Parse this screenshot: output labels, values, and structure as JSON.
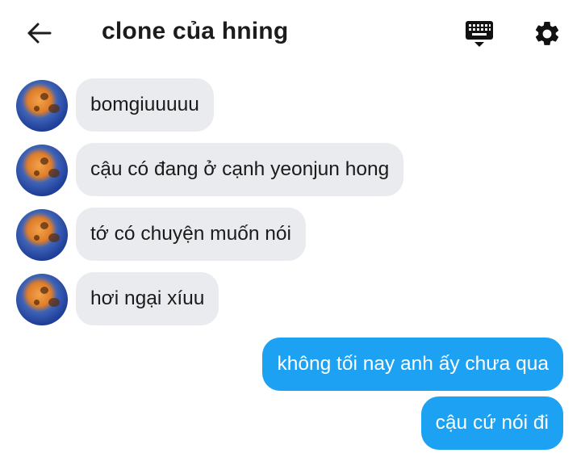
{
  "header": {
    "title": "clone của hning",
    "back_icon": "arrow-left-icon",
    "keyboard_icon": "keyboard-icon",
    "settings_icon": "gear-icon"
  },
  "messages": [
    {
      "side": "incoming",
      "text": "bomgiuuuuu"
    },
    {
      "side": "incoming",
      "text": "cậu có đang ở cạnh yeonjun hong"
    },
    {
      "side": "incoming",
      "text": "tớ có chuyện muốn nói"
    },
    {
      "side": "incoming",
      "text": "hơi ngại xíuu"
    },
    {
      "side": "outgoing",
      "text": "không tối nay anh ấy chưa qua"
    },
    {
      "side": "outgoing",
      "text": "cậu cứ nói đi"
    }
  ],
  "colors": {
    "incoming_bubble": "#e9ebee",
    "outgoing_bubble": "#1da1f2",
    "text_dark": "#1b1b1b"
  }
}
